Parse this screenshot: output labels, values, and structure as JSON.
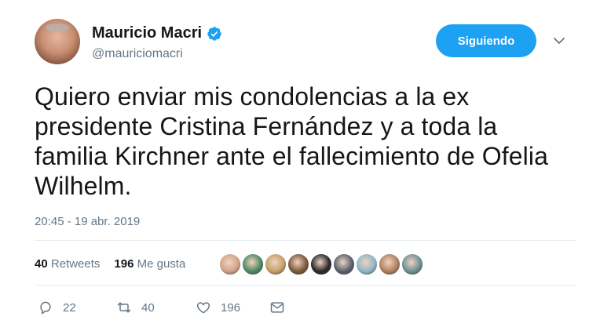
{
  "user": {
    "name": "Mauricio Macri",
    "handle": "@mauriciomacri"
  },
  "follow_button": {
    "label": "Siguiendo"
  },
  "tweet": {
    "text_lines": [
      "Quiero enviar mis condolencias a la ex",
      "presidente Cristina Fernández y a toda la",
      "familia Kirchner ante el fallecimiento de Ofelia",
      "Wilhelm."
    ],
    "timestamp": "20:45 - 19 abr. 2019"
  },
  "stats": {
    "retweets_count": "40",
    "retweets_label": "Retweets",
    "likes_count": "196",
    "likes_label": "Me gusta"
  },
  "liker_avatars": [
    {
      "color": "#d4a389"
    },
    {
      "color": "#4e8a62"
    },
    {
      "color": "#c6a06a"
    },
    {
      "color": "#7a5a3a"
    },
    {
      "color": "#2a2a2a"
    },
    {
      "color": "#5a6270"
    },
    {
      "color": "#8fb7c9"
    },
    {
      "color": "#b08060"
    },
    {
      "color": "#6f8f95"
    }
  ],
  "actions": {
    "reply_count": "22",
    "retweet_count": "40",
    "like_count": "196"
  },
  "colors": {
    "accent": "#1da1f2",
    "text": "#14171a",
    "secondary": "#657786"
  }
}
